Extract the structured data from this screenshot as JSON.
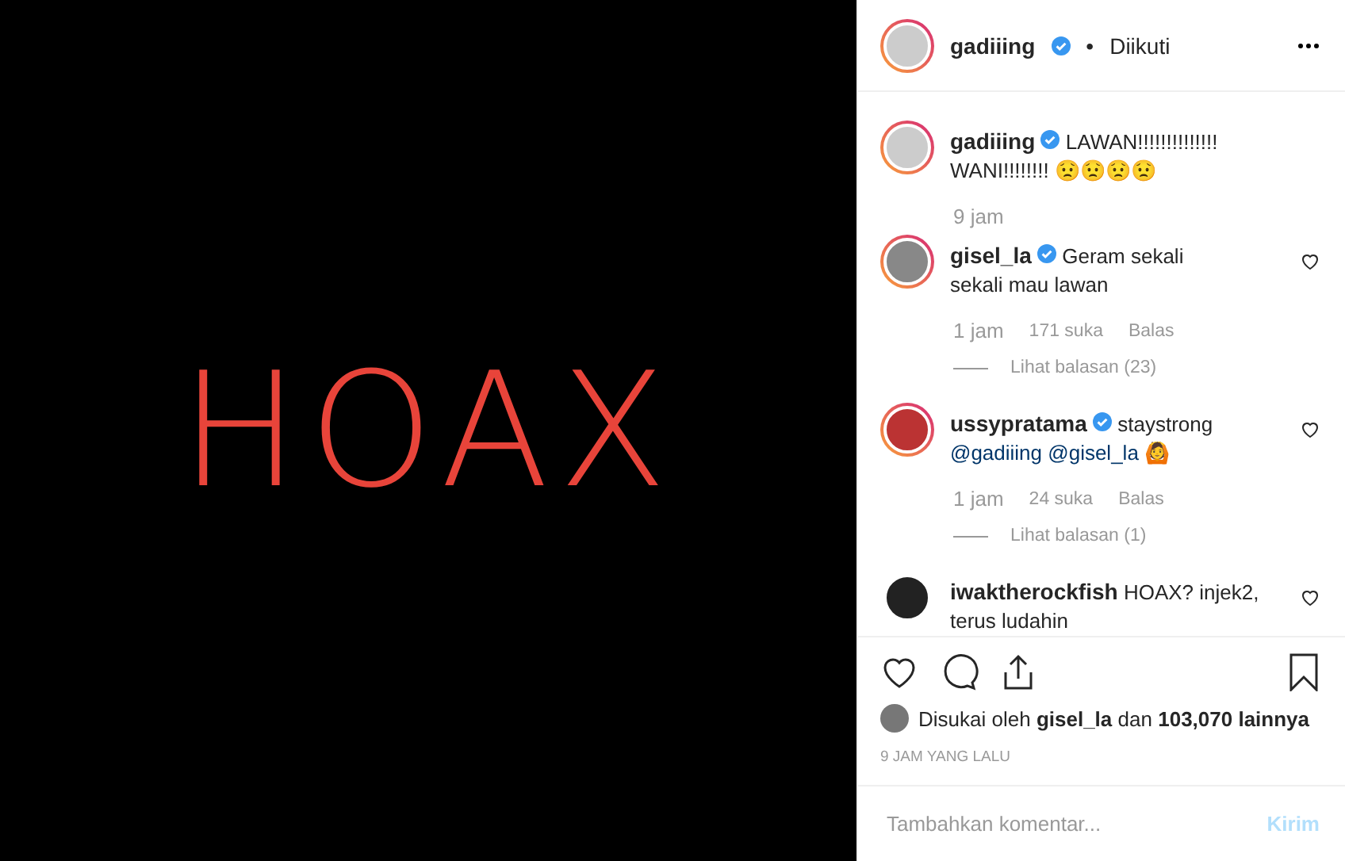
{
  "post_image": {
    "text": "HOAX"
  },
  "header": {
    "username": "gadiiing",
    "verified": true,
    "separator": "•",
    "follow_status": "Diikuti",
    "story_ring": true
  },
  "caption": {
    "username": "gadiiing",
    "verified": true,
    "text": "LAWAN!!!!!!!!!!!!!! WANI!!!!!!!! 😟😟😟😟",
    "time": "9 jam",
    "story_ring": true
  },
  "comments": [
    {
      "username": "gisel_la",
      "verified": true,
      "story_ring": true,
      "text": "Geram sekali sekali mau lawan",
      "time": "1 jam",
      "likes": "171 suka",
      "reply": "Balas",
      "view_replies": "Lihat balasan (23)"
    },
    {
      "username": "ussypratama",
      "verified": true,
      "story_ring": true,
      "text": "staystrong",
      "mentions": [
        "@gadiiing",
        "@gisel_la"
      ],
      "suffix": "🙆",
      "time": "1 jam",
      "likes": "24 suka",
      "reply": "Balas",
      "view_replies": "Lihat balasan (1)"
    },
    {
      "username": "iwaktherockfish",
      "verified": false,
      "story_ring": false,
      "text": "HOAX? injek2, terus ludahin"
    }
  ],
  "likes": {
    "prefix": "Disukai oleh",
    "user": "gisel_la",
    "middle": "dan",
    "count": "103,070 lainnya"
  },
  "timestamp": "9 JAM YANG LALU",
  "comment_box": {
    "placeholder": "Tambahkan komentar...",
    "submit": "Kirim",
    "disabled": true
  }
}
